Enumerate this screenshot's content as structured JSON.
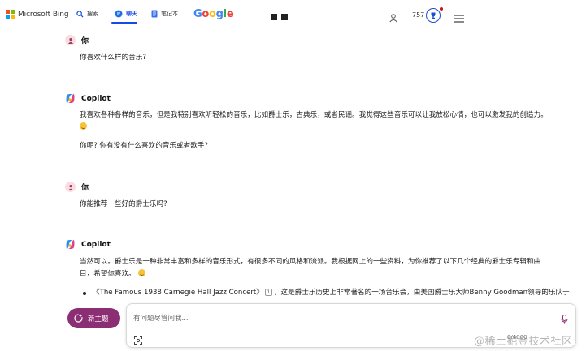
{
  "header": {
    "brand": "Microsoft Bing",
    "nav": {
      "search_label": "搜索",
      "chat_label": "聊天",
      "notes_label": "笔记本"
    },
    "google_letters": [
      "G",
      "o",
      "o",
      "g",
      "l",
      "e"
    ],
    "points": "757"
  },
  "conversation": [
    {
      "role": "你",
      "text": "你喜欢什么样的音乐?"
    },
    {
      "role": "Copilot",
      "paragraph1": "我喜欢各种各样的音乐，但是我特别喜欢听轻松的音乐，比如爵士乐，古典乐，或者民谣。我觉得这些音乐可以让我放松心情，也可以激发我的创造力。",
      "paragraph2": "你呢? 你有没有什么喜欢的音乐或者歌手?"
    },
    {
      "role": "你",
      "text": "你能推荐一些好的爵士乐吗?"
    },
    {
      "role": "Copilot",
      "paragraph1_line1": "当然可以。爵士乐是一种非常丰富和多样的音乐形式，有很多不同的风格和流派。我根据网上的一些资料，为你推荐了以下几个经典的爵士乐专辑和曲",
      "paragraph1_line2": "目，希望你喜欢。",
      "bullet_album": "《The Famous 1938 Carnegie Hall Jazz Concert》",
      "bullet_ref": "1",
      "bullet_rest": "，这是爵士乐历史上非常著名的一场音乐会，由美国爵士乐大师Benny Goodman领导的乐队于"
    }
  ],
  "composer": {
    "new_topic_label": "新主题",
    "placeholder": "有问题尽管问我...",
    "counter": "0/4000"
  },
  "watermark": "@稀土掘金技术社区",
  "colors": {
    "accent": "#174ae4",
    "new_topic": "#8b2e73"
  }
}
